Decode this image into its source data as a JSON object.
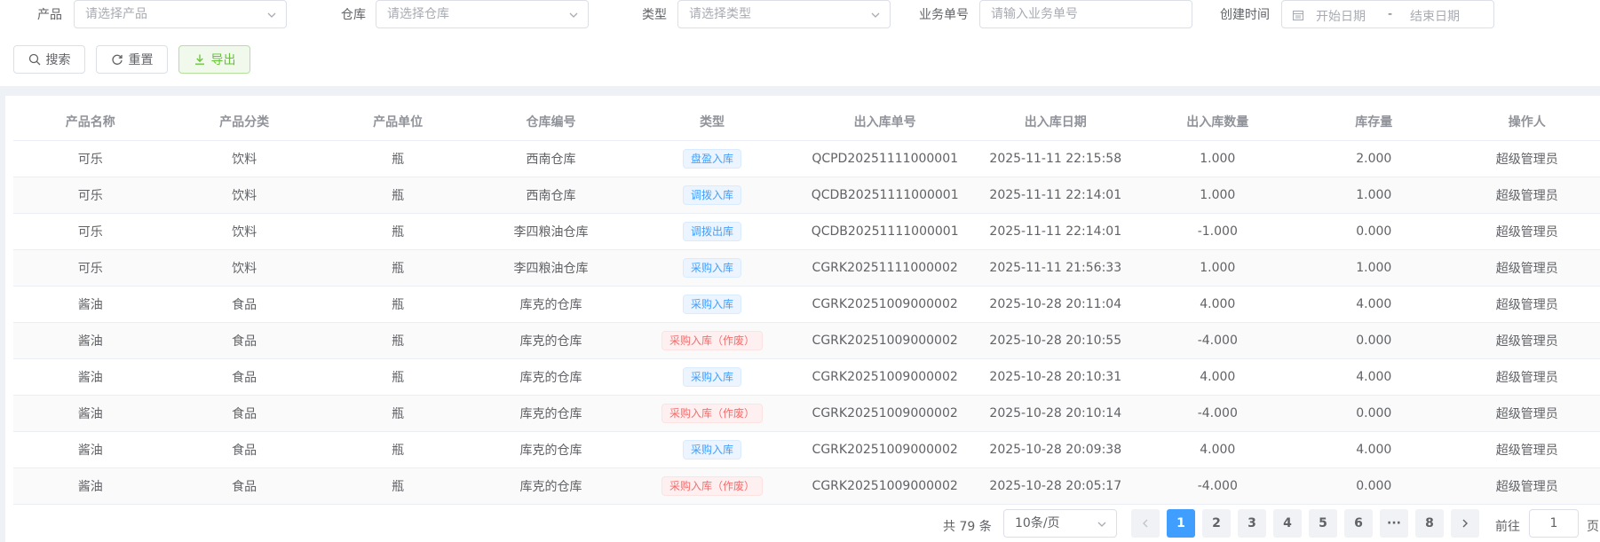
{
  "filters": {
    "product": {
      "label": "产品",
      "placeholder": "请选择产品"
    },
    "warehouse": {
      "label": "仓库",
      "placeholder": "请选择仓库"
    },
    "type": {
      "label": "类型",
      "placeholder": "请选择类型"
    },
    "bizno": {
      "label": "业务单号",
      "placeholder": "请输入业务单号"
    },
    "created": {
      "label": "创建时间",
      "start_placeholder": "开始日期",
      "separator": "-",
      "end_placeholder": "结束日期"
    }
  },
  "actions": {
    "search": "搜索",
    "reset": "重置",
    "export": "导出"
  },
  "table": {
    "headers": [
      "产品名称",
      "产品分类",
      "产品单位",
      "仓库编号",
      "类型",
      "出入库单号",
      "出入库日期",
      "出入库数量",
      "库存量",
      "操作人"
    ],
    "rows": [
      {
        "name": "可乐",
        "category": "饮料",
        "unit": "瓶",
        "warehouse": "西南仓库",
        "type": "盘盈入库",
        "type_style": "primary",
        "no": "QCPD20251111000001",
        "date": "2025-11-11 22:15:58",
        "qty": "1.000",
        "stock": "2.000",
        "operator": "超级管理员"
      },
      {
        "name": "可乐",
        "category": "饮料",
        "unit": "瓶",
        "warehouse": "西南仓库",
        "type": "调拨入库",
        "type_style": "primary",
        "no": "QCDB20251111000001",
        "date": "2025-11-11 22:14:01",
        "qty": "1.000",
        "stock": "1.000",
        "operator": "超级管理员"
      },
      {
        "name": "可乐",
        "category": "饮料",
        "unit": "瓶",
        "warehouse": "李四粮油仓库",
        "type": "调拨出库",
        "type_style": "primary",
        "no": "QCDB20251111000001",
        "date": "2025-11-11 22:14:01",
        "qty": "-1.000",
        "stock": "0.000",
        "operator": "超级管理员"
      },
      {
        "name": "可乐",
        "category": "饮料",
        "unit": "瓶",
        "warehouse": "李四粮油仓库",
        "type": "采购入库",
        "type_style": "primary",
        "no": "CGRK20251111000002",
        "date": "2025-11-11 21:56:33",
        "qty": "1.000",
        "stock": "1.000",
        "operator": "超级管理员"
      },
      {
        "name": "酱油",
        "category": "食品",
        "unit": "瓶",
        "warehouse": "库克的仓库",
        "type": "采购入库",
        "type_style": "primary",
        "no": "CGRK20251009000002",
        "date": "2025-10-28 20:11:04",
        "qty": "4.000",
        "stock": "4.000",
        "operator": "超级管理员"
      },
      {
        "name": "酱油",
        "category": "食品",
        "unit": "瓶",
        "warehouse": "库克的仓库",
        "type": "采购入库（作废）",
        "type_style": "danger",
        "no": "CGRK20251009000002",
        "date": "2025-10-28 20:10:55",
        "qty": "-4.000",
        "stock": "0.000",
        "operator": "超级管理员"
      },
      {
        "name": "酱油",
        "category": "食品",
        "unit": "瓶",
        "warehouse": "库克的仓库",
        "type": "采购入库",
        "type_style": "primary",
        "no": "CGRK20251009000002",
        "date": "2025-10-28 20:10:31",
        "qty": "4.000",
        "stock": "4.000",
        "operator": "超级管理员"
      },
      {
        "name": "酱油",
        "category": "食品",
        "unit": "瓶",
        "warehouse": "库克的仓库",
        "type": "采购入库（作废）",
        "type_style": "danger",
        "no": "CGRK20251009000002",
        "date": "2025-10-28 20:10:14",
        "qty": "-4.000",
        "stock": "0.000",
        "operator": "超级管理员"
      },
      {
        "name": "酱油",
        "category": "食品",
        "unit": "瓶",
        "warehouse": "库克的仓库",
        "type": "采购入库",
        "type_style": "primary",
        "no": "CGRK20251009000002",
        "date": "2025-10-28 20:09:38",
        "qty": "4.000",
        "stock": "4.000",
        "operator": "超级管理员"
      },
      {
        "name": "酱油",
        "category": "食品",
        "unit": "瓶",
        "warehouse": "库克的仓库",
        "type": "采购入库（作废）",
        "type_style": "danger",
        "no": "CGRK20251009000002",
        "date": "2025-10-28 20:05:17",
        "qty": "-4.000",
        "stock": "0.000",
        "operator": "超级管理员"
      }
    ]
  },
  "pagination": {
    "total": "共 79 条",
    "page_size": "10条/页",
    "pages": [
      "1",
      "2",
      "3",
      "4",
      "5",
      "6",
      "···",
      "8"
    ],
    "current": "1",
    "goto_label": "前往",
    "goto_value": "1",
    "goto_unit": "页"
  },
  "colors": {
    "primary": "#409eff",
    "danger": "#f56c6c",
    "success": "#67c23a"
  }
}
